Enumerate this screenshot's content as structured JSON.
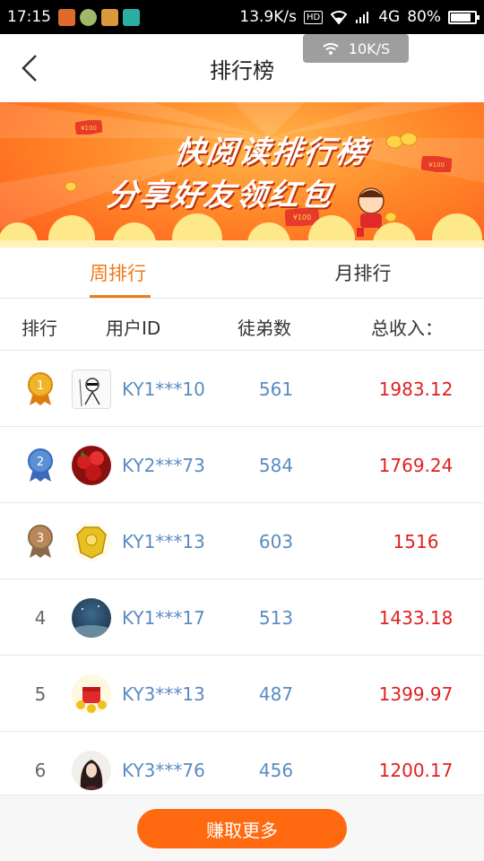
{
  "status_bar": {
    "time": "17:15",
    "network_speed": "13.9K/s",
    "hd": "HD",
    "network_type": "4G",
    "battery": "80%"
  },
  "speed_toast": {
    "value": "10K/S"
  },
  "header": {
    "title": "排行榜"
  },
  "banner": {
    "line1": "快阅读排行榜",
    "line2": "分享好友领红包",
    "envelope_label": "¥100"
  },
  "tabs": [
    {
      "label": "周排行",
      "active": true
    },
    {
      "label": "月排行",
      "active": false
    }
  ],
  "columns": {
    "rank": "排行",
    "user_id": "用户ID",
    "disciples": "徒弟数",
    "income": "总收入："
  },
  "rows": [
    {
      "rank": "1",
      "medal": "gold",
      "user_id": "KY1***10",
      "disciples": "561",
      "income": "1983.12",
      "avatar": "sketch-figure"
    },
    {
      "rank": "2",
      "medal": "silver",
      "user_id": "KY2***73",
      "disciples": "584",
      "income": "1769.24",
      "avatar": "strawberries"
    },
    {
      "rank": "3",
      "medal": "bronze",
      "user_id": "KY1***13",
      "disciples": "603",
      "income": "1516",
      "avatar": "golden-armor"
    },
    {
      "rank": "4",
      "medal": null,
      "user_id": "KY1***17",
      "disciples": "513",
      "income": "1433.18",
      "avatar": "night-scene"
    },
    {
      "rank": "5",
      "medal": null,
      "user_id": "KY3***13",
      "disciples": "487",
      "income": "1399.97",
      "avatar": "red-gift"
    },
    {
      "rank": "6",
      "medal": null,
      "user_id": "KY3***76",
      "disciples": "456",
      "income": "1200.17",
      "avatar": "girl-portrait"
    }
  ],
  "colors": {
    "accent": "#f07a1a",
    "button": "#ff6a10",
    "income": "#e02020",
    "link": "#5a8bc2",
    "gold": "#f0b429",
    "silver": "#5b8fd6",
    "bronze": "#b8885a"
  },
  "bottom": {
    "button_label": "赚取更多"
  }
}
